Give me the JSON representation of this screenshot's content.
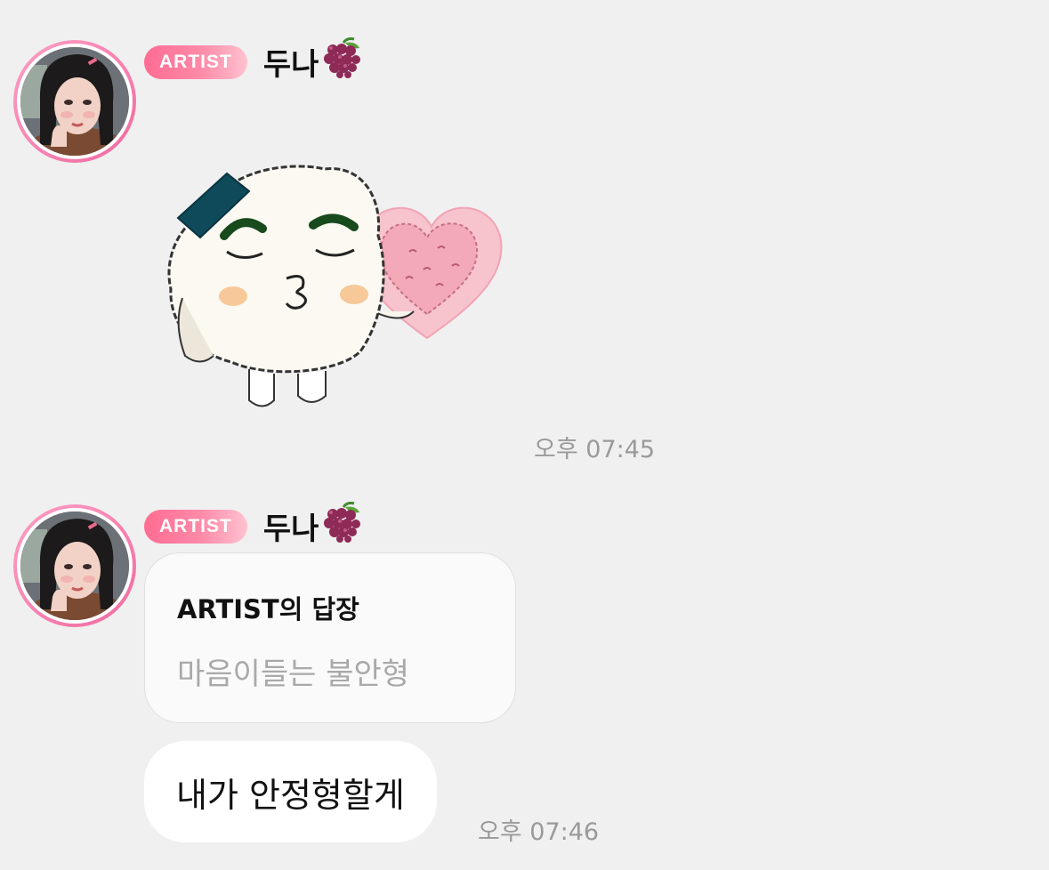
{
  "messages": [
    {
      "badge": "ARTIST",
      "sender": "두나",
      "sender_emoji": "grape-icon",
      "content_type": "sticker",
      "sticker": "rice-ball-kiss-heart-sticker",
      "time": "오후 07:45"
    },
    {
      "badge": "ARTIST",
      "sender": "두나",
      "sender_emoji": "grape-icon",
      "content_type": "reply",
      "reply": {
        "title": "ARTIST의 답장",
        "quote": "마음이들는 불안형"
      },
      "text": "내가 안정형할게",
      "time": "오후 07:46"
    }
  ],
  "colors": {
    "background": "#f0f0f0",
    "badge_gradient_start": "#ff6c92",
    "badge_gradient_end": "#ffc2d0",
    "avatar_ring": "#f06aa0",
    "timestamp": "#9a9a9a"
  }
}
